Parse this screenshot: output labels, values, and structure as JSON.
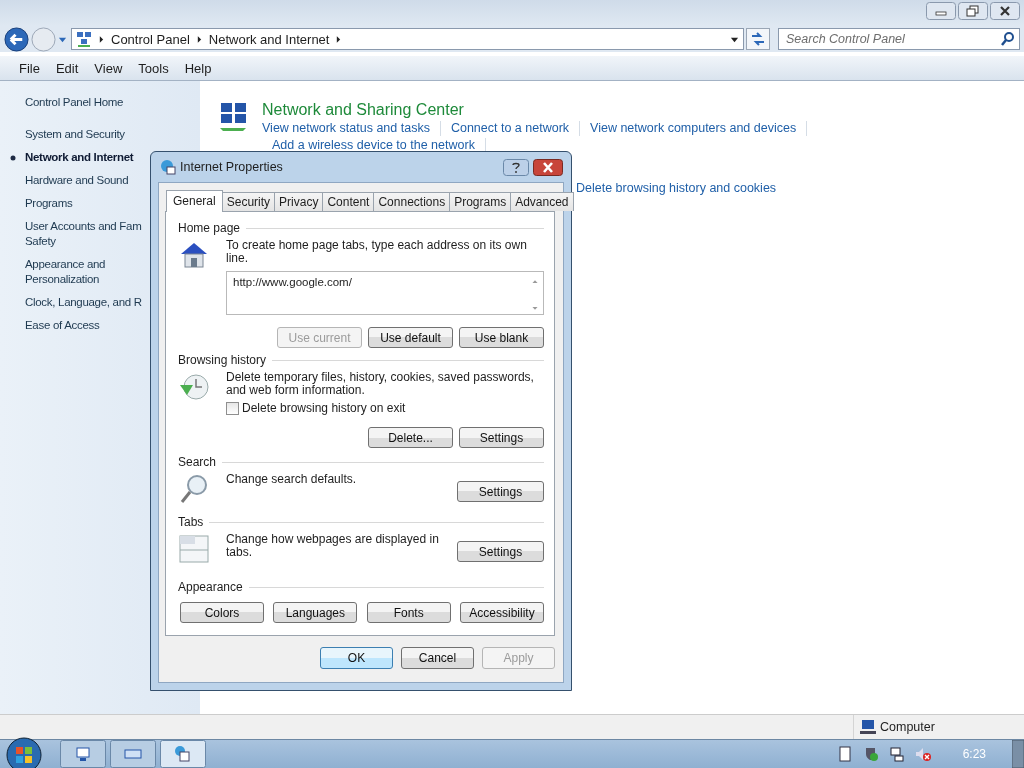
{
  "address_bar": {
    "crumbs": [
      "Control Panel",
      "Network and Internet"
    ],
    "search_placeholder": "Search Control Panel"
  },
  "menu": [
    "File",
    "Edit",
    "View",
    "Tools",
    "Help"
  ],
  "sidebar": {
    "items": [
      {
        "lines": [
          "Control Panel Home"
        ],
        "selected": false
      },
      {
        "lines": [
          "System and Security"
        ],
        "selected": false
      },
      {
        "lines": [
          "Network and Internet"
        ],
        "selected": true
      },
      {
        "lines": [
          "Hardware and Sound"
        ],
        "selected": false
      },
      {
        "lines": [
          "Programs"
        ],
        "selected": false
      },
      {
        "lines": [
          "User Accounts and Fam",
          "Safety"
        ],
        "selected": false
      },
      {
        "lines": [
          "Appearance and",
          "Personalization"
        ],
        "selected": false
      },
      {
        "lines": [
          "Clock, Language, and R"
        ],
        "selected": false
      },
      {
        "lines": [
          "Ease of Access"
        ],
        "selected": false
      }
    ]
  },
  "categories": [
    {
      "kind": "network",
      "title": "Network and Sharing Center",
      "links": [
        "View network status and tasks",
        "Connect to a network",
        "View network computers and devices",
        "Add a wireless device to the network"
      ]
    },
    {
      "kind": "hidden",
      "links": [
        "Delete browsing history and cookies"
      ]
    }
  ],
  "dialog": {
    "title": "Internet Properties",
    "tabs": [
      {
        "label": "General",
        "selected": true
      },
      {
        "label": "Security",
        "selected": false
      },
      {
        "label": "Privacy",
        "selected": false
      },
      {
        "label": "Content",
        "selected": false
      },
      {
        "label": "Connections",
        "selected": false
      },
      {
        "label": "Programs",
        "selected": false
      },
      {
        "label": "Advanced",
        "selected": false
      }
    ],
    "sections": [
      {
        "kind": "home",
        "heading": "Home page",
        "description": "To create home page tabs, type each address on its own line.",
        "value": "http://www.google.com/",
        "buttons": [
          {
            "label": "Use current",
            "disabled": true
          },
          {
            "label": "Use default",
            "disabled": false
          },
          {
            "label": "Use blank",
            "disabled": false
          }
        ]
      },
      {
        "kind": "history",
        "heading": "Browsing history",
        "description": "Delete temporary files, history, cookies, saved passwords, and web form information.",
        "checkbox": {
          "label": "Delete browsing history on exit",
          "checked": false
        },
        "buttons": [
          {
            "label": "Delete...",
            "disabled": false
          },
          {
            "label": "Settings",
            "disabled": false
          }
        ]
      },
      {
        "kind": "search",
        "heading": "Search",
        "description": "Change search defaults.",
        "buttons": [
          {
            "label": "Settings",
            "disabled": false
          }
        ]
      },
      {
        "kind": "tabs",
        "heading": "Tabs",
        "description": "Change how webpages are displayed in tabs.",
        "buttons": [
          {
            "label": "Settings",
            "disabled": false
          }
        ]
      },
      {
        "kind": "appearance",
        "heading": "Appearance",
        "buttons": [
          {
            "label": "Colors",
            "disabled": false
          },
          {
            "label": "Languages",
            "disabled": false
          },
          {
            "label": "Fonts",
            "disabled": false
          },
          {
            "label": "Accessibility",
            "disabled": false
          }
        ]
      }
    ],
    "footer": [
      {
        "label": "OK",
        "disabled": false,
        "default": true
      },
      {
        "label": "Cancel",
        "disabled": false,
        "default": false
      },
      {
        "label": "Apply",
        "disabled": true,
        "default": false
      }
    ]
  },
  "status_bar": {
    "text": "Computer"
  },
  "taskbar": {
    "clock": "6:23"
  }
}
